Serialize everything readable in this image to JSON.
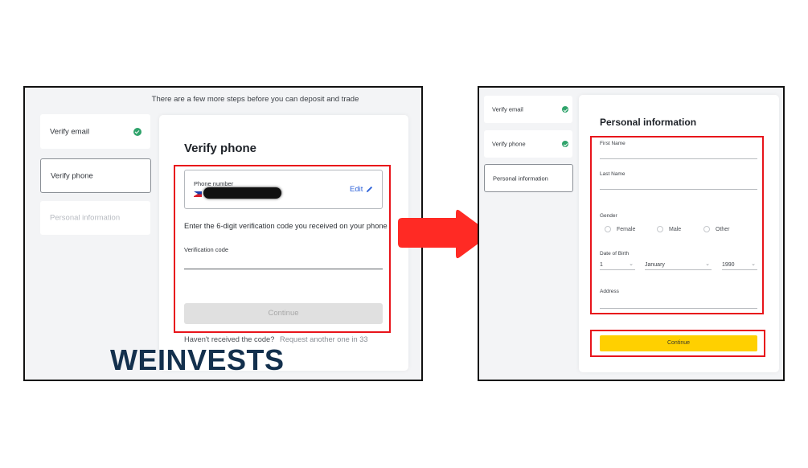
{
  "left_screen": {
    "top_note": "There are a few more steps before you can deposit and trade",
    "steps": [
      {
        "label": "Verify email",
        "state": "completed"
      },
      {
        "label": "Verify phone",
        "state": "active"
      },
      {
        "label": "Personal information",
        "state": "disabled"
      }
    ],
    "card": {
      "title": "Verify phone",
      "phone_label": "Phone number",
      "phone_value": "[redacted]",
      "country_flag": "Philippines",
      "edit_label": "Edit",
      "instruction": "Enter the 6-digit verification code you received on your phone",
      "verification_label": "Verification code",
      "verification_value": "",
      "continue_label": "Continue",
      "resend_prompt": "Haven't received the code?",
      "resend_countdown": "Request another one in 33"
    }
  },
  "right_screen": {
    "steps": [
      {
        "label": "Verify email",
        "state": "completed"
      },
      {
        "label": "Verify phone",
        "state": "completed"
      },
      {
        "label": "Personal information",
        "state": "active"
      }
    ],
    "card": {
      "title": "Personal information",
      "first_name_label": "First Name",
      "first_name_value": "",
      "last_name_label": "Last Name",
      "last_name_value": "",
      "gender_label": "Gender",
      "gender_options": [
        "Female",
        "Male",
        "Other"
      ],
      "dob_label": "Date of Birth",
      "dob_day": "1",
      "dob_month": "January",
      "dob_year": "1990",
      "address_label": "Address",
      "address_value": "",
      "continue_label": "Continue"
    }
  },
  "watermark": "WEINVESTS",
  "colors": {
    "highlight_red": "#e8141b",
    "arrow_red": "#ff2a24",
    "check_green": "#2fa36b",
    "continue_yellow": "#ffd000",
    "link_blue": "#2f63d9",
    "logo_navy": "#13304d"
  },
  "icons": {
    "check": "check-circle-icon",
    "edit": "pencil-icon",
    "chevron": "chevron-down-icon",
    "arrow": "arrow-right-icon",
    "flag": "flag-ph-icon"
  }
}
